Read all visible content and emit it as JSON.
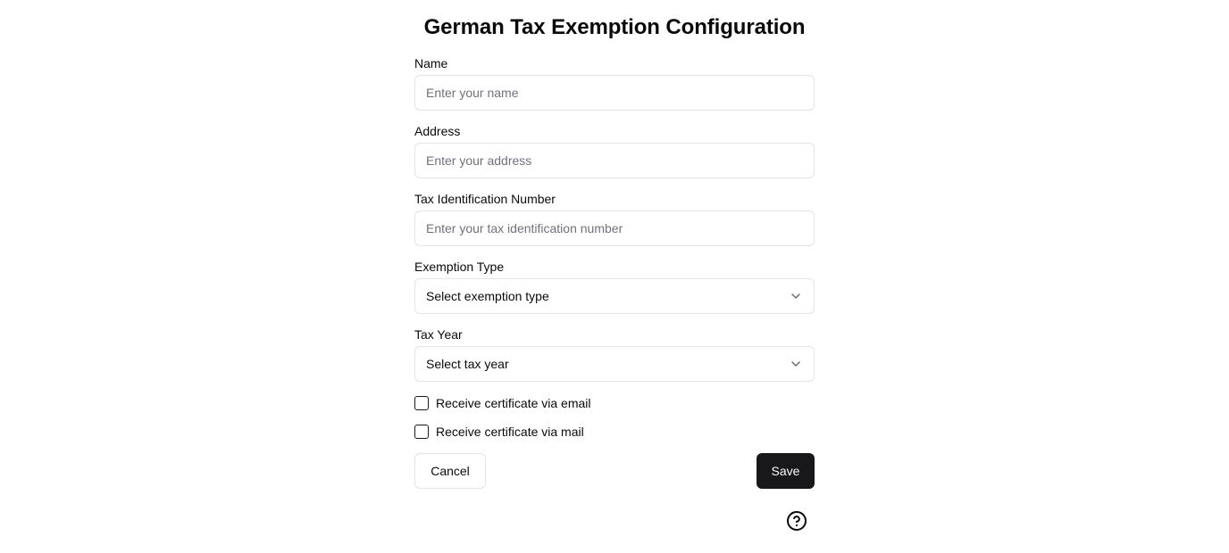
{
  "page": {
    "title": "German Tax Exemption Configuration"
  },
  "form": {
    "name": {
      "label": "Name",
      "value": "",
      "placeholder": "Enter your name"
    },
    "address": {
      "label": "Address",
      "value": "",
      "placeholder": "Enter your address"
    },
    "tax_id": {
      "label": "Tax Identification Number",
      "value": "",
      "placeholder": "Enter your tax identification number"
    },
    "exemption_type": {
      "label": "Exemption Type",
      "selected": "Select exemption type",
      "icon": "chevron-down-icon"
    },
    "tax_year": {
      "label": "Tax Year",
      "selected": "Select tax year",
      "icon": "chevron-down-icon"
    },
    "email_certificate": {
      "label": "Receive certificate via email",
      "checked": false
    },
    "mail_certificate": {
      "label": "Receive certificate via mail",
      "checked": false
    }
  },
  "actions": {
    "cancel_label": "Cancel",
    "save_label": "Save",
    "help_icon": "help-circle-icon"
  },
  "colors": {
    "primary_button": "#18181b",
    "border": "#e4e4e7",
    "placeholder": "#71717a"
  }
}
